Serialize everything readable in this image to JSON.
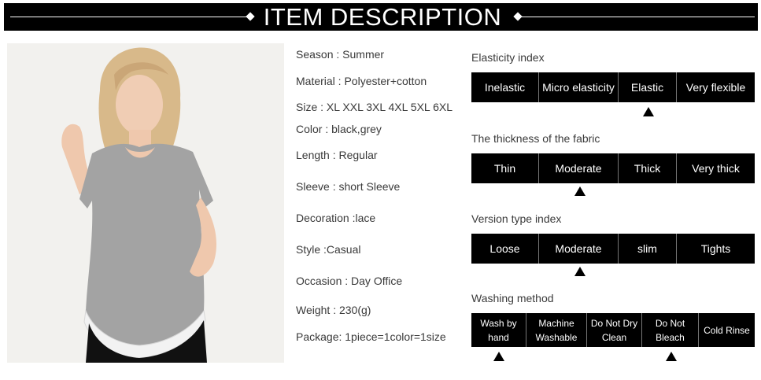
{
  "header": {
    "title": "ITEM DESCRIPTION"
  },
  "specs": [
    "Season : Summer",
    "Material : Polyester+cotton",
    "Size : XL XXL 3XL 4XL 5XL 6XL",
    "Color : black,grey",
    "Length : Regular",
    "Sleeve : short Sleeve",
    "Decoration :lace",
    "Style :Casual",
    "Occasion : Day Office",
    "Weight : 230(g)",
    "Package: 1piece=1color=1size"
  ],
  "indexes": {
    "elasticity": {
      "title": "Elasticity index",
      "options": [
        "Inelastic",
        "Micro elasticity",
        "Elastic",
        "Very flexible"
      ],
      "selected": [
        "Elastic"
      ]
    },
    "thickness": {
      "title": "The thickness of the fabric",
      "options": [
        "Thin",
        "Moderate",
        "Thick",
        "Very thick"
      ],
      "selected": [
        "Moderate"
      ]
    },
    "version": {
      "title": "Version type index",
      "options": [
        "Loose",
        "Moderate",
        "slim",
        "Tights"
      ],
      "selected": [
        "Moderate"
      ]
    },
    "washing": {
      "title": "Washing method",
      "options": [
        "Wash by hand",
        "Machine Washable",
        "Do Not Dry Clean",
        "Do Not Bleach",
        "Cold Rinse"
      ],
      "selected": [
        "Wash by hand",
        "Do Not Bleach"
      ]
    }
  },
  "colors": {
    "banner": "#000000",
    "shirt": "#a3a3a3",
    "pants": "#111111",
    "lace": "#f2f2f2",
    "hair": "#d8b98a"
  },
  "image": {
    "subject": "model-wearing-grey-lace-trim-tshirt"
  }
}
